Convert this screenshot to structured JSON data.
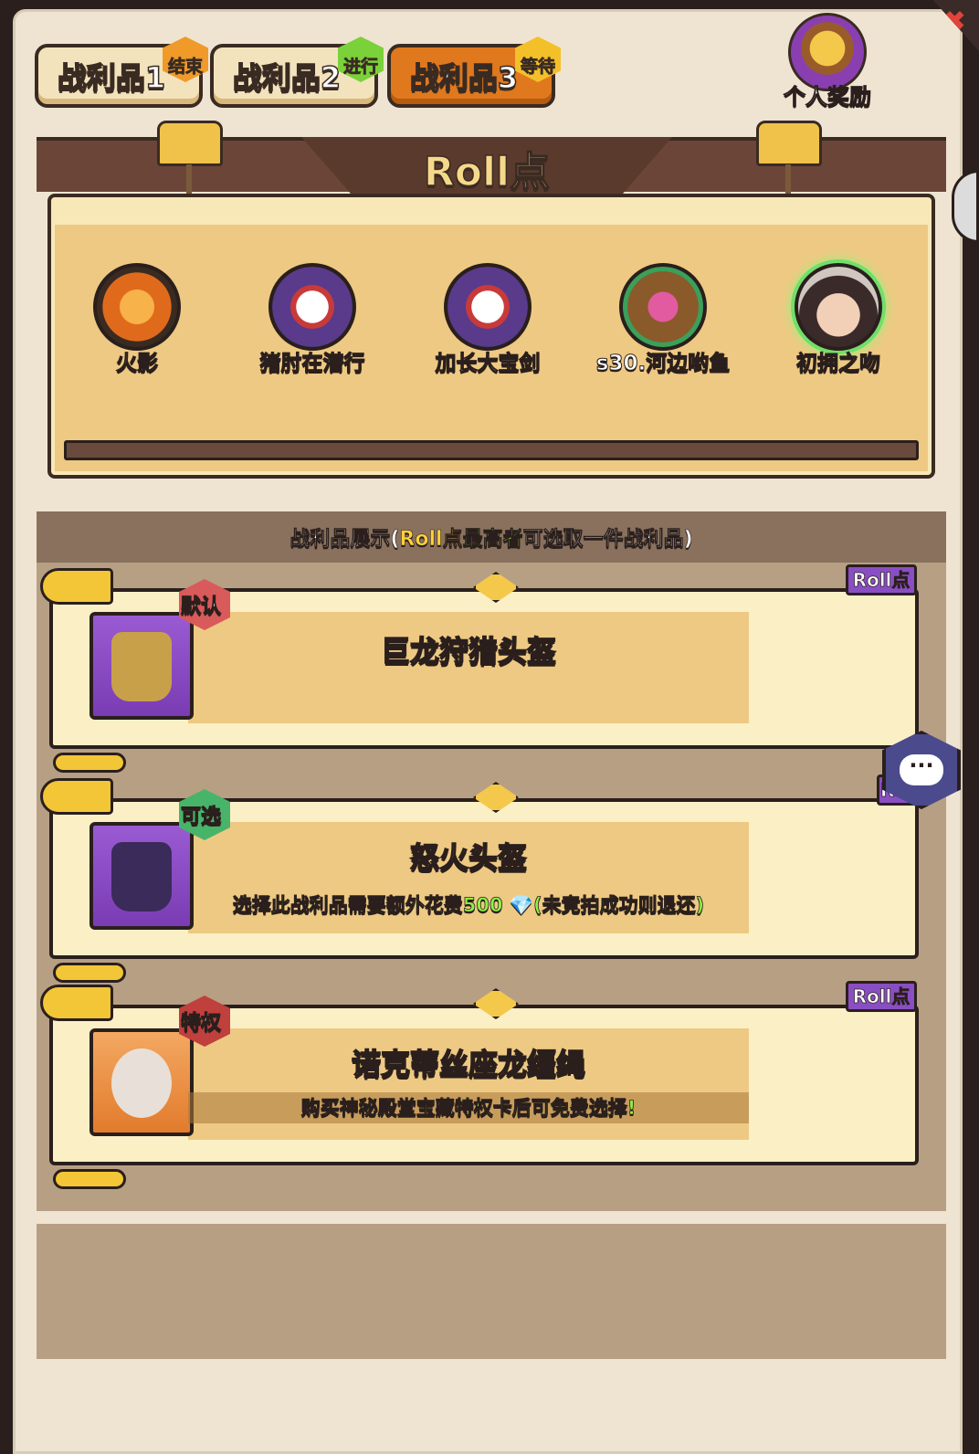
{
  "tabs": [
    {
      "label": "战利品1",
      "badge": "结束"
    },
    {
      "label": "战利品2",
      "badge": "进行"
    },
    {
      "label": "战利品3",
      "badge": "等待"
    }
  ],
  "personal_reward": {
    "label": "个人奖励",
    "icon": "treasure-chest-icon"
  },
  "roll": {
    "title": "Roll点",
    "players": [
      {
        "name": "火影",
        "highlighted": false
      },
      {
        "name": "猪肘在潜行",
        "highlighted": false
      },
      {
        "name": "加长大宝剑",
        "highlighted": false
      },
      {
        "name": "s30.河边哟鱼",
        "highlighted": false
      },
      {
        "name": "初拥之吻",
        "highlighted": true
      }
    ],
    "progress_fraction": 0
  },
  "loot": {
    "header_prefix": "战利品展示(",
    "header_roll": "Roll点",
    "header_highest": "最高者",
    "header_suffix": "可选取一件战利品)",
    "roll_tag": "Roll点",
    "roll_tag_partial": "Rol",
    "items": [
      {
        "status": "默认",
        "name": "巨龙狩猎头盔",
        "note": "",
        "icon": "dragon-helmet-icon"
      },
      {
        "status": "可选",
        "name": "怒火头盔",
        "note": "选择此战利品需要额外花费500 💎(未竞拍成功则退还)",
        "icon": "fury-helmet-icon"
      },
      {
        "status": "特权",
        "name": "诺克蒂丝座龙缰绳",
        "note": "购买神秘殿堂宝藏特权卡后可免费选择!",
        "icon": "dragon-reins-icon"
      }
    ]
  },
  "chat": {
    "label": "···",
    "icon": "chat-bubble-icon"
  },
  "close": {
    "label": "✖",
    "icon": "close-icon"
  },
  "colors": {
    "accent": "#e0781e",
    "panel": "#efe4d2",
    "purple_name": "#d98cf2",
    "green_text": "#8ef044"
  }
}
